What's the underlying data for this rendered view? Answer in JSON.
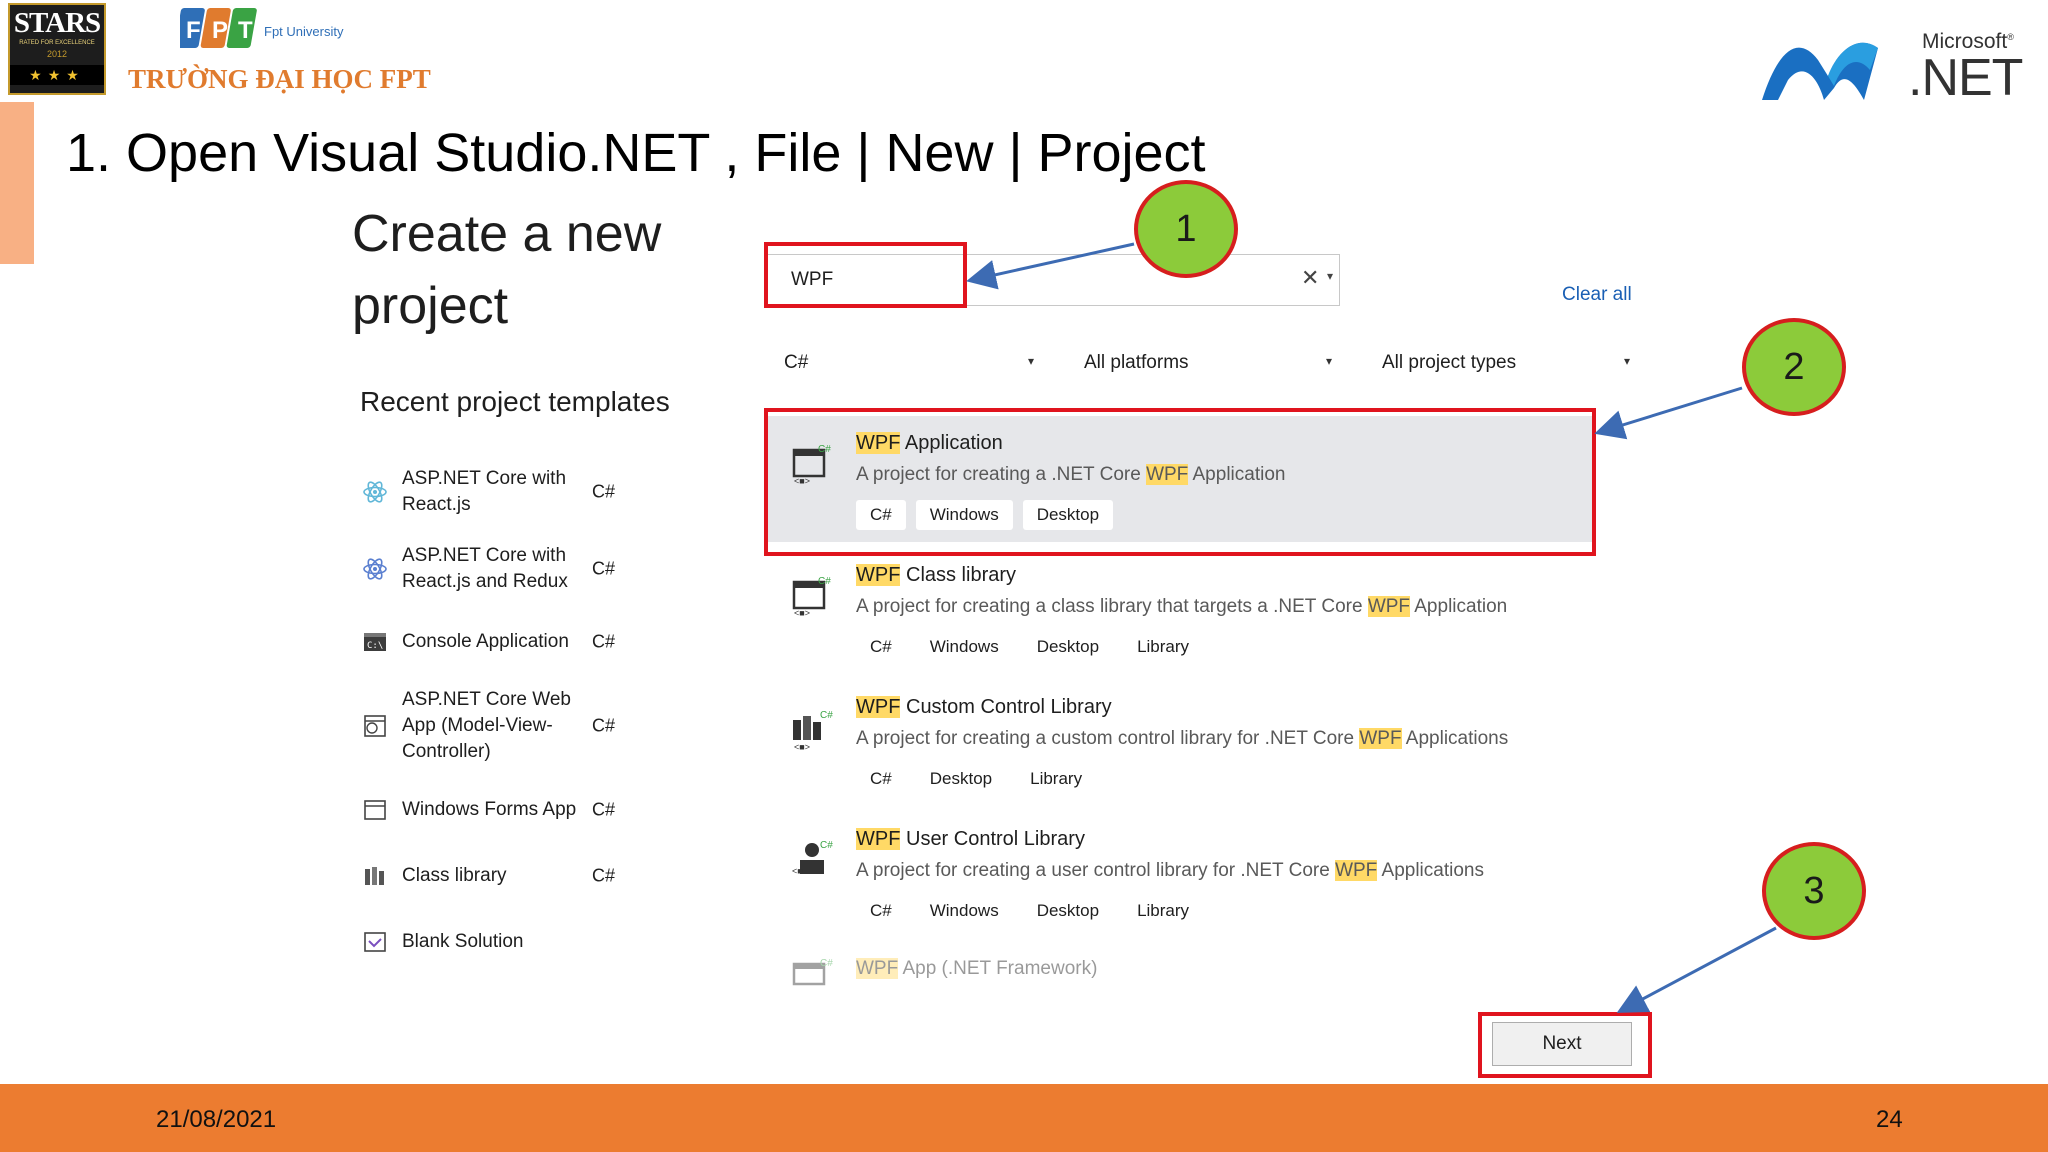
{
  "slide": {
    "title": "1. Open Visual Studio.NET , File | New | Project",
    "footer_date": "21/08/2021",
    "page_number": "24"
  },
  "logos": {
    "stars_text": "STARS",
    "stars_sub": "RATED FOR EXCELLENCE",
    "stars_year": "2012",
    "fpt_university": "Fpt University",
    "fpt_name": "TRƯỜNG ĐẠI HỌC FPT",
    "microsoft": "Microsoft",
    "net": ".NET"
  },
  "dialog": {
    "heading": "Create a new project",
    "recent_heading": "Recent project templates",
    "recent": [
      {
        "name": "ASP.NET Core with React.js",
        "lang": "C#",
        "icon": "react-icon"
      },
      {
        "name": "ASP.NET Core with React.js and Redux",
        "lang": "C#",
        "icon": "react-redux-icon"
      },
      {
        "name": "Console Application",
        "lang": "C#",
        "icon": "console-icon"
      },
      {
        "name": "ASP.NET Core Web App (Model-View-Controller)",
        "lang": "C#",
        "icon": "web-app-icon"
      },
      {
        "name": "Windows Forms App",
        "lang": "C#",
        "icon": "window-form-icon"
      },
      {
        "name": "Class library",
        "lang": "C#",
        "icon": "class-library-icon"
      },
      {
        "name": "Blank Solution",
        "lang": "",
        "icon": "blank-solution-icon"
      }
    ],
    "search_value": "WPF",
    "clear_all": "Clear all",
    "filters": {
      "language": "C#",
      "platform": "All platforms",
      "project_type": "All project types"
    },
    "templates": [
      {
        "title_hl": "WPF",
        "title_rest": " Application",
        "desc_pre": "A project for creating a .NET Core ",
        "desc_hl": "WPF",
        "desc_post": " Application",
        "tags": [
          "C#",
          "Windows",
          "Desktop"
        ]
      },
      {
        "title_hl": "WPF",
        "title_rest": " Class library",
        "desc_pre": "A project for creating a class library that targets a .NET Core ",
        "desc_hl": "WPF",
        "desc_post": " Application",
        "tags": [
          "C#",
          "Windows",
          "Desktop",
          "Library"
        ]
      },
      {
        "title_hl": "WPF",
        "title_rest": " Custom Control Library",
        "desc_pre": "A project for creating a custom control library for .NET Core ",
        "desc_hl": "WPF",
        "desc_post": " Applications",
        "tags": [
          "C#",
          "Desktop",
          "Library"
        ]
      },
      {
        "title_hl": "WPF",
        "title_rest": " User Control Library",
        "desc_pre": "A project for creating a user control library for .NET Core ",
        "desc_hl": "WPF",
        "desc_post": " Applications",
        "tags": [
          "C#",
          "Windows",
          "Desktop",
          "Library"
        ]
      }
    ],
    "faded_template": {
      "title_hl": "WPF",
      "title_rest": " App (.NET Framework)"
    },
    "next_button": "Next"
  },
  "callouts": [
    "1",
    "2",
    "3"
  ],
  "colors": {
    "accent_orange": "#ec7c30",
    "callout_fill": "#8ccb3a",
    "callout_border": "#d61e1e",
    "highlight": "#ffd966",
    "link_blue": "#1a5fb4"
  }
}
